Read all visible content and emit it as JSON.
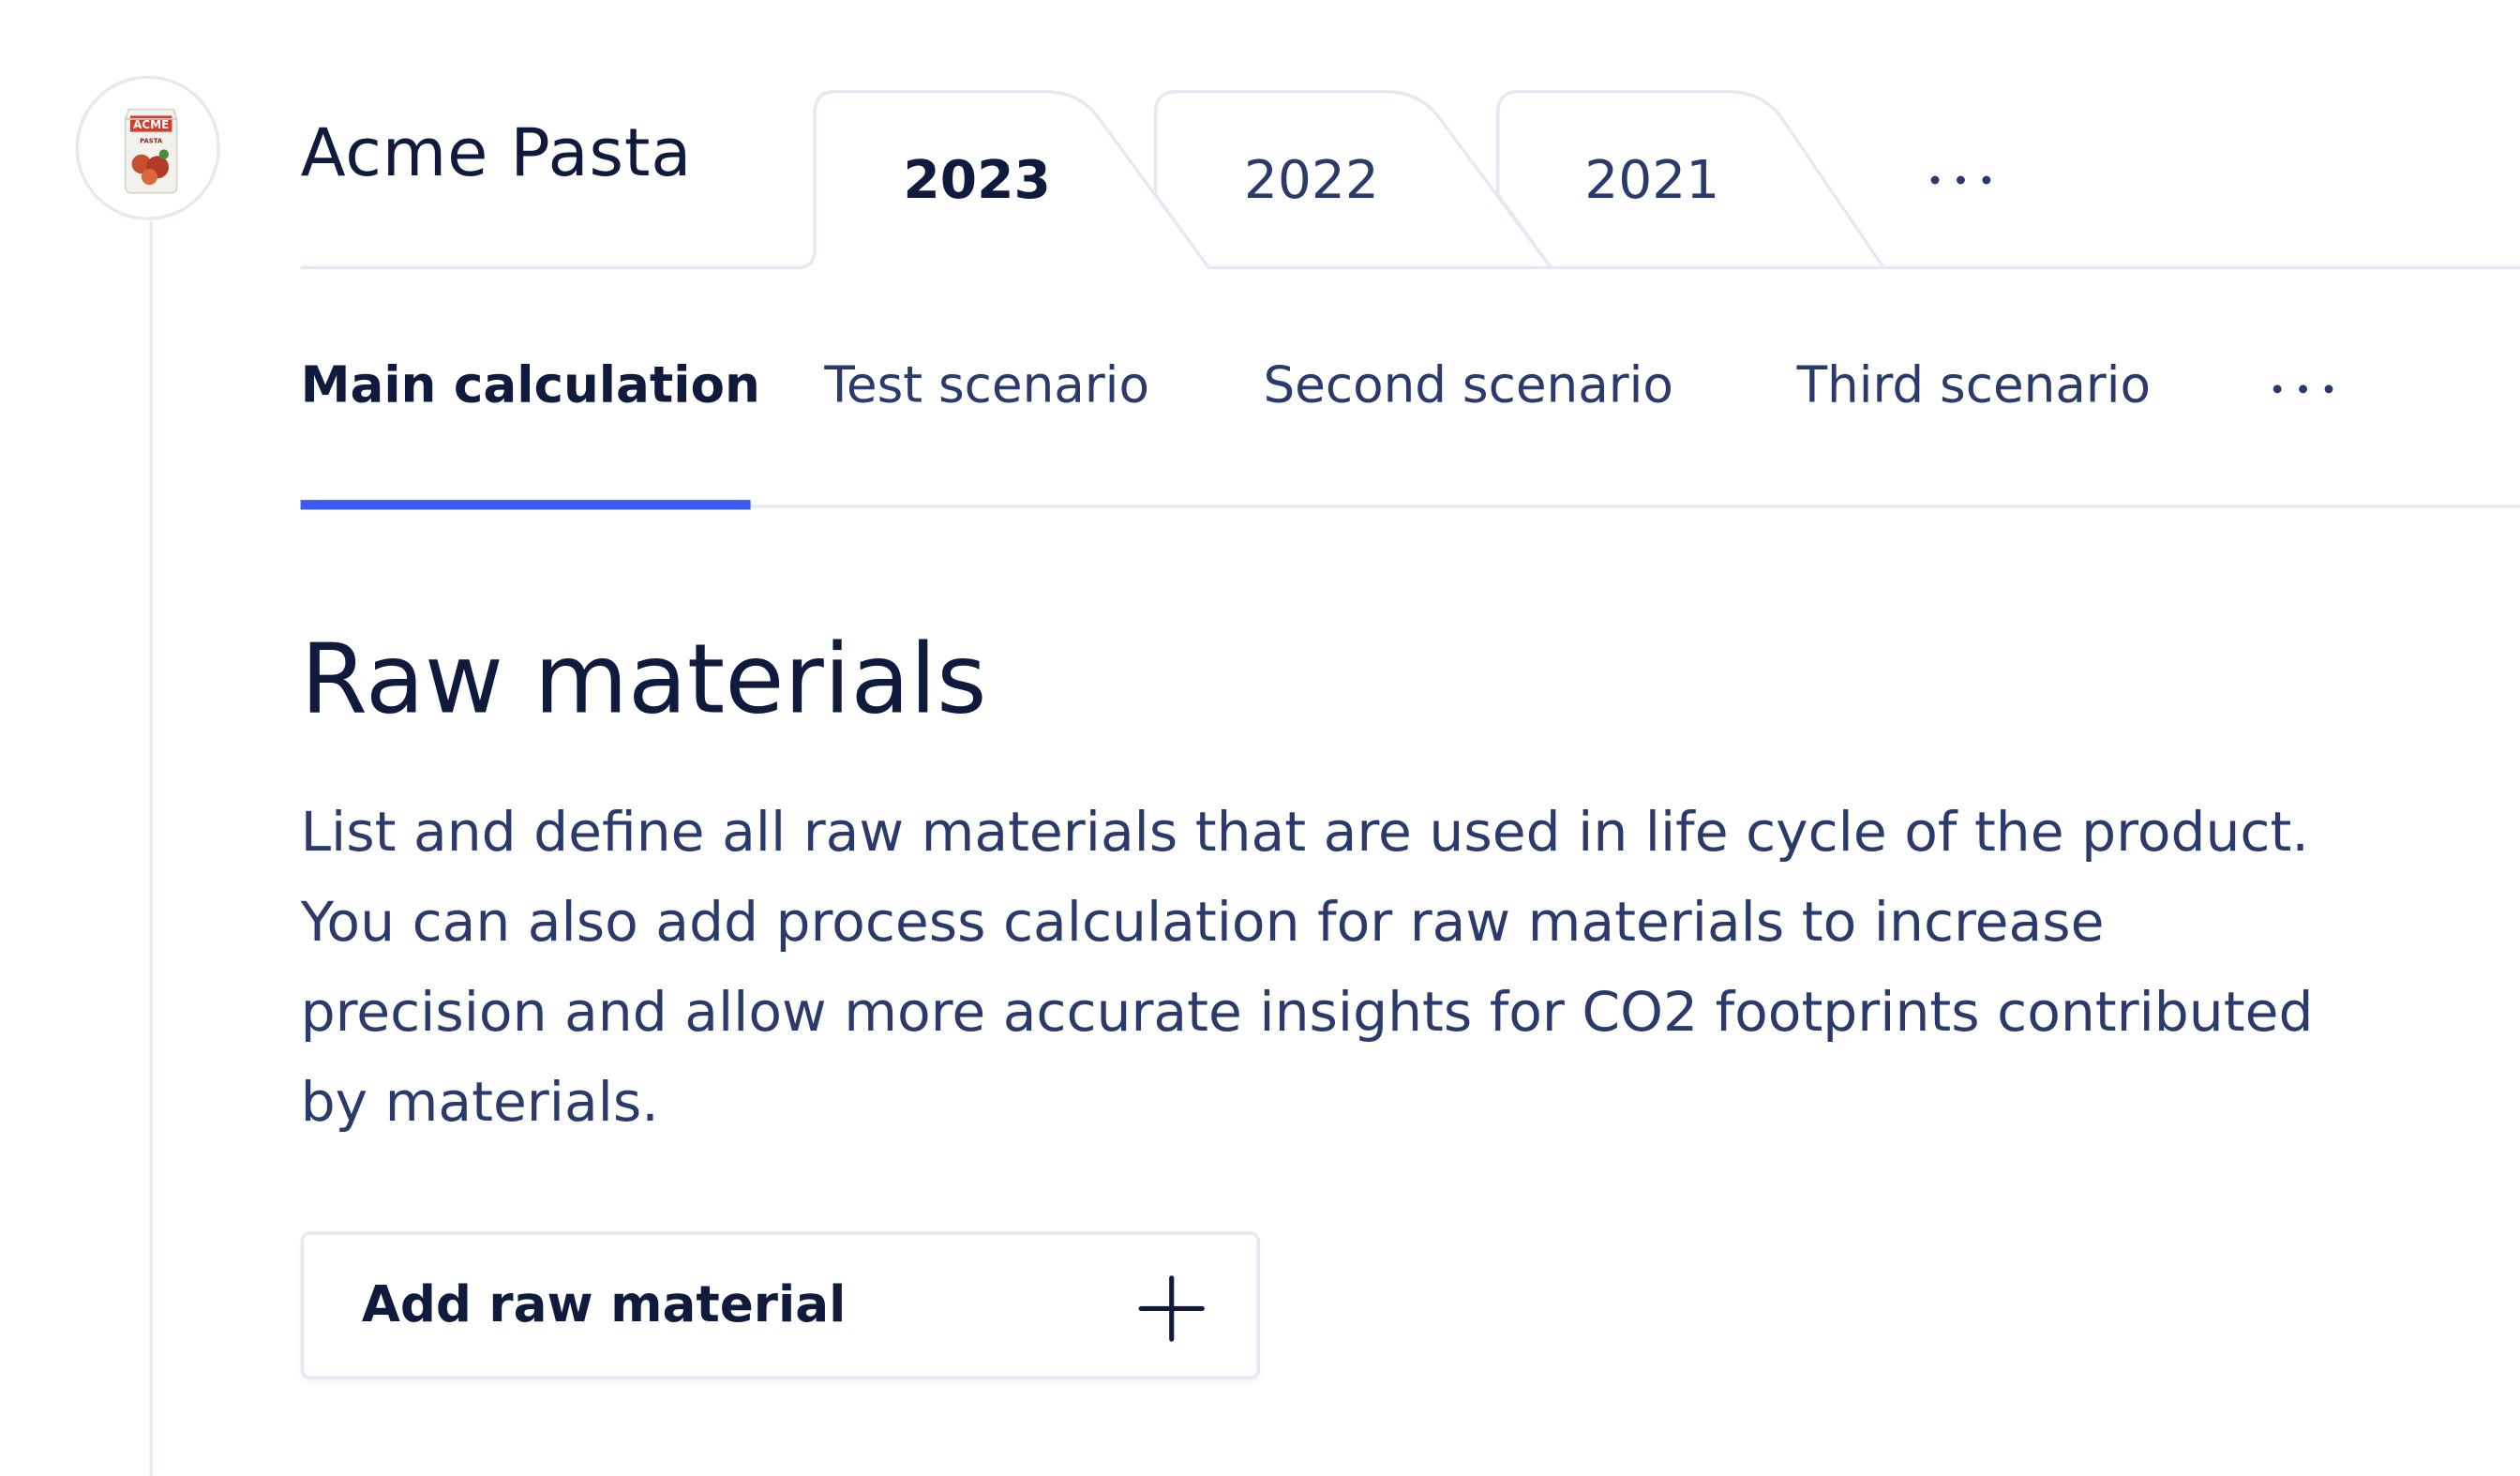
{
  "product": {
    "name": "Acme Pasta",
    "thumbnail_icon": "pasta-package-thumbnail",
    "thumbnail_text": [
      "ACME",
      "PASTA"
    ]
  },
  "year_tabs": {
    "items": [
      {
        "label": "2023",
        "active": true
      },
      {
        "label": "2022",
        "active": false
      },
      {
        "label": "2021",
        "active": false
      }
    ],
    "more_icon": "more-horizontal-icon"
  },
  "scenario_tabs": {
    "items": [
      {
        "label": "Main calculation",
        "active": true
      },
      {
        "label": "Test scenario",
        "active": false
      },
      {
        "label": "Second scenario",
        "active": false
      },
      {
        "label": "Third scenario",
        "active": false
      }
    ],
    "more_icon": "more-horizontal-icon"
  },
  "section": {
    "title": "Raw materials",
    "description": "List and define all raw materials that are used in life cycle of the product. You can also add process calculation for raw materials to increase precision and allow more accurate insights for CO2 footprints contributed by materials."
  },
  "add_button": {
    "label": "Add raw material",
    "icon": "plus-icon"
  },
  "colors": {
    "text_primary": "#0f1a3d",
    "text_secondary": "#2b3a6b",
    "accent": "#3b5bf5",
    "border": "#e6e9f1"
  }
}
